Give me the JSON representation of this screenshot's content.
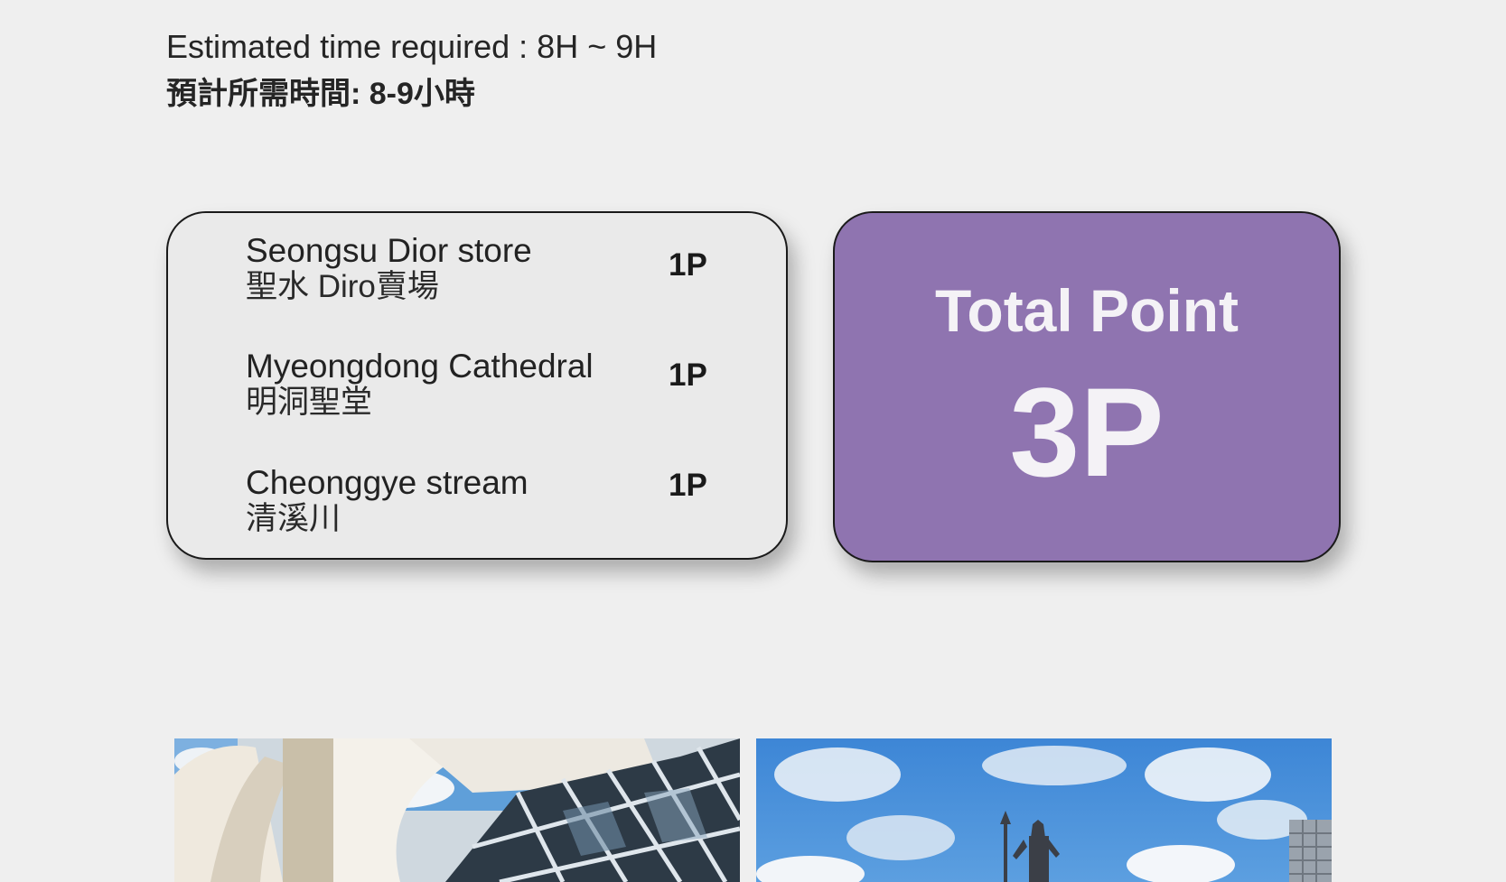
{
  "time": {
    "en": "Estimated time required : 8H ~ 9H",
    "zh": "預計所需時間:  8-9小時"
  },
  "places": [
    {
      "en": "Seongsu Dior store",
      "zh": "聖水 Diro賣場",
      "points": "1P"
    },
    {
      "en": "Myeongdong Cathedral",
      "zh": "明洞聖堂",
      "points": "1P"
    },
    {
      "en": "Cheonggye stream",
      "zh": "清溪川",
      "points": "1P"
    }
  ],
  "total": {
    "label": "Total Point",
    "value": "3P"
  },
  "colors": {
    "background": "#efefef",
    "total_card": "#8f74b0",
    "list_card": "#eaeaea"
  },
  "photos": [
    {
      "icon": "building-photo"
    },
    {
      "icon": "statue-photo"
    }
  ]
}
